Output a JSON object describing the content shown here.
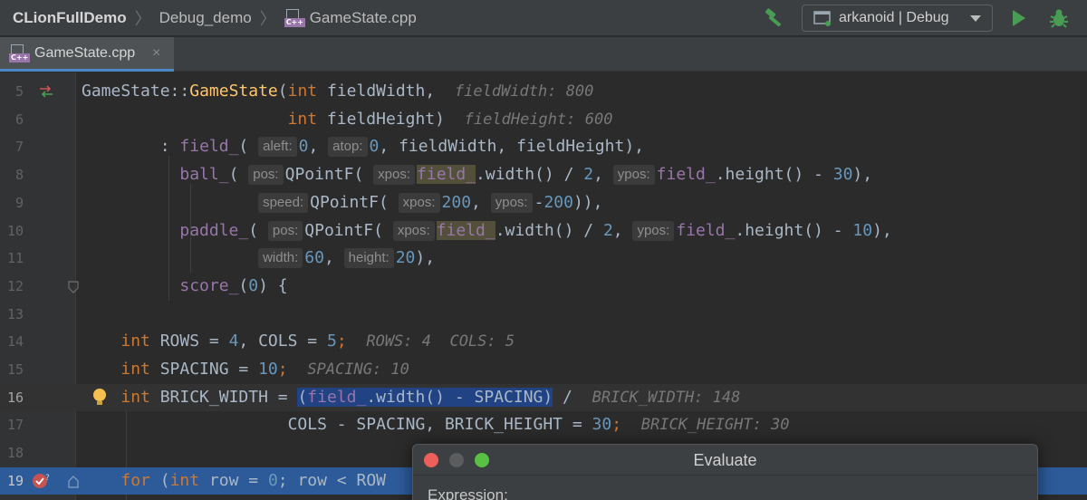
{
  "navbar": {
    "project": "CLionFullDemo",
    "folder": "Debug_demo",
    "file": "GameState.cpp",
    "run_config": "arkanoid | Debug",
    "file_icon_tag": "C++"
  },
  "tabs": [
    {
      "label": "GameState.cpp",
      "close": "×"
    }
  ],
  "editor": {
    "line_numbers": [
      "5",
      "6",
      "7",
      "8",
      "9",
      "10",
      "11",
      "12",
      "13",
      "14",
      "15",
      "16",
      "17",
      "18",
      "19"
    ],
    "current_line": "16",
    "execution_line": "19"
  },
  "code": {
    "l5": {
      "a": "GameState",
      "b": "::",
      "c": "GameState",
      "d": "(",
      "e": "int",
      "f": " fieldWidth,",
      "inlay": "fieldWidth: 800"
    },
    "l6": {
      "e": "int",
      "f": " fieldHeight)",
      "inlay": "fieldHeight: 600"
    },
    "l7": {
      "a": ": ",
      "b": "field_",
      "c": "(",
      "h1": "aleft:",
      "n1": "0",
      "d": ", ",
      "h2": "atop:",
      "n2": "0",
      "e": ", fieldWidth, fieldHeight),"
    },
    "l8": {
      "a": "ball_",
      "b": "(",
      "h1": "pos:",
      "c": "QPointF(",
      "h2": "xpos:",
      "d": "field_",
      "e": ".width() / ",
      "n1": "2",
      "f": ", ",
      "h3": "ypos:",
      "g": "field_",
      "i": ".height() - ",
      "n2": "30",
      "j": "),"
    },
    "l9": {
      "h1": "speed:",
      "c": "QPointF(",
      "h2": "xpos:",
      "n1": "200",
      "d": ", ",
      "h3": "ypos:",
      "e": "-",
      "n2": "200",
      "f": ")),"
    },
    "l10": {
      "a": "paddle_",
      "b": "(",
      "h1": "pos:",
      "c": "QPointF(",
      "h2": "xpos:",
      "d": "field_",
      "e": ".width() / ",
      "n1": "2",
      "f": ", ",
      "h3": "ypos:",
      "g": "field_",
      "i": ".height() - ",
      "n2": "10",
      "j": "),"
    },
    "l11": {
      "h1": "width:",
      "n1": "60",
      "d": ", ",
      "h2": "height:",
      "n2": "20",
      "e": "),"
    },
    "l12": {
      "a": "score_",
      "b": "(",
      "n1": "0",
      "c": ") {"
    },
    "l14": {
      "k": "int",
      "a": " ROWS = ",
      "n1": "4",
      "b": ", COLS = ",
      "n2": "5",
      "c": ";",
      "inlay": "ROWS: 4  COLS: 5"
    },
    "l15": {
      "k": "int",
      "a": " SPACING = ",
      "n1": "10",
      "c": ";",
      "inlay": "SPACING: 10"
    },
    "l16": {
      "k": "int",
      "a": " BRICK_WIDTH = ",
      "s1": "(",
      "s2": "field_",
      "s3": ".width() - SPACING)",
      "b": " /",
      "inlay": "BRICK_WIDTH: 148"
    },
    "l17": {
      "a": "COLS - SPACING, BRICK_HEIGHT = ",
      "n1": "30",
      "c": ";",
      "inlay": "BRICK_HEIGHT: 30"
    },
    "l19": {
      "k": "for",
      "a": " (",
      "k2": "int",
      "b": " row = ",
      "n1": "0",
      "c": "; row < ROW"
    }
  },
  "evaluate_dialog": {
    "title": "Evaluate",
    "expression_label": "Expression:"
  },
  "colors": {
    "keyword": "#cc7832",
    "function": "#ffc66d",
    "field": "#9876aa",
    "number": "#6897bb",
    "run_green": "#499c54",
    "selection": "#214283",
    "execution_line": "#2d5b9a"
  }
}
